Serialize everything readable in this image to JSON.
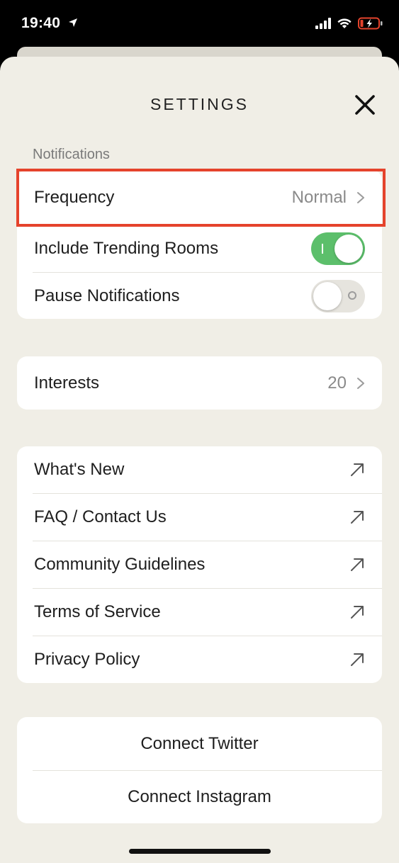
{
  "status_bar": {
    "time": "19:40"
  },
  "header": {
    "title": "SETTINGS"
  },
  "notifications": {
    "section_label": "Notifications",
    "frequency": {
      "label": "Frequency",
      "value": "Normal"
    },
    "trending": {
      "label": "Include Trending Rooms",
      "state": "on"
    },
    "pause": {
      "label": "Pause Notifications",
      "state": "off"
    }
  },
  "interests": {
    "label": "Interests",
    "value": "20"
  },
  "links": [
    {
      "label": "What's New"
    },
    {
      "label": "FAQ / Contact Us"
    },
    {
      "label": "Community Guidelines"
    },
    {
      "label": "Terms of Service"
    },
    {
      "label": "Privacy Policy"
    }
  ],
  "connect": [
    {
      "label": "Connect Twitter"
    },
    {
      "label": "Connect Instagram"
    }
  ],
  "colors": {
    "background": "#f0eee6",
    "toggle_on": "#5cbf6b",
    "highlight": "#e5432c"
  },
  "icons": [
    "location-arrow-icon",
    "signal-icon",
    "wifi-icon",
    "battery-icon",
    "close-icon",
    "chevron-right-icon",
    "external-link-icon"
  ]
}
